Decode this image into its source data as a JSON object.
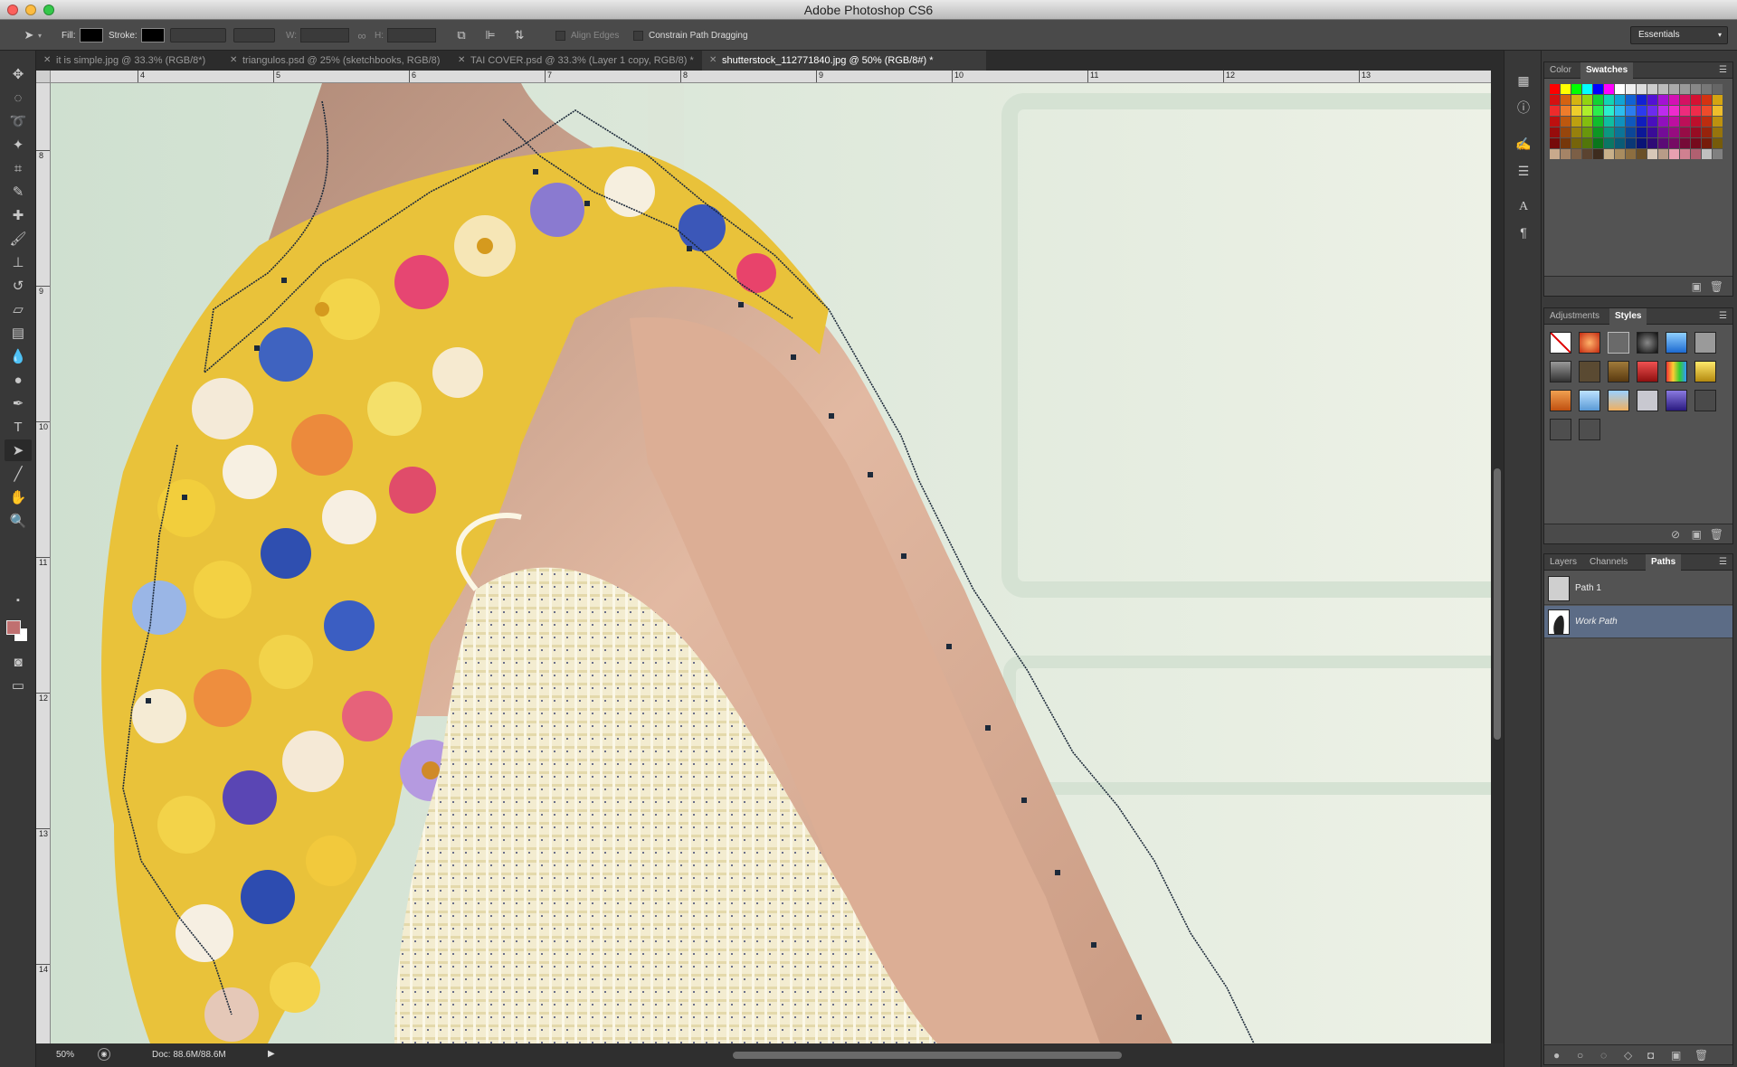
{
  "window": {
    "title": "Adobe Photoshop CS6"
  },
  "options_bar": {
    "fill_label": "Fill:",
    "stroke_label": "Stroke:",
    "w_label": "W:",
    "h_label": "H:",
    "align_edges_label": "Align Edges",
    "constrain_label": "Constrain Path Dragging",
    "workspace_label": "Essentials"
  },
  "tabs": [
    {
      "label": "it is simple.jpg @ 33.3% (RGB/8*)"
    },
    {
      "label": "triangulos.psd @ 25% (sketchbooks, RGB/8)"
    },
    {
      "label": "TAI COVER.psd @ 33.3% (Layer 1 copy, RGB/8) *"
    },
    {
      "label": "shutterstock_112771840.jpg @ 50% (RGB/8#) *"
    }
  ],
  "ruler_top": [
    "4",
    "5",
    "6",
    "7",
    "8",
    "9",
    "10",
    "11",
    "12",
    "13"
  ],
  "ruler_left": [
    "8",
    "9",
    "10",
    "11",
    "12",
    "13",
    "14"
  ],
  "status": {
    "zoom": "50%",
    "doc": "Doc: 88.6M/88.6M"
  },
  "color_panel": {
    "tabs": [
      "Color",
      "Swatches"
    ]
  },
  "styles_panel": {
    "tabs": [
      "Adjustments",
      "Styles"
    ]
  },
  "layers_panel": {
    "tabs": [
      "Layers",
      "Channels",
      "Paths"
    ],
    "paths": [
      {
        "name": "Path 1"
      },
      {
        "name": "Work Path"
      }
    ]
  }
}
